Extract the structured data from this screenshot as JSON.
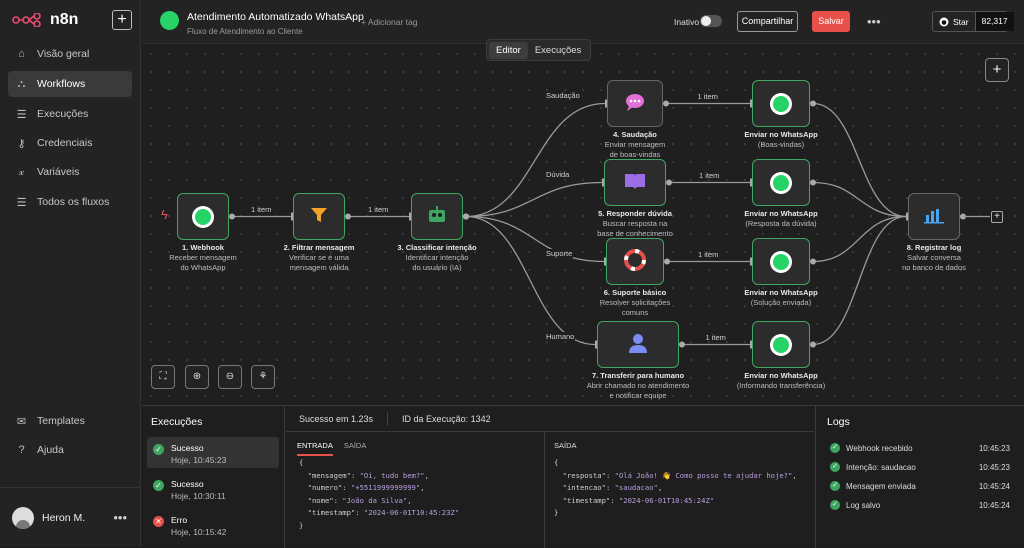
{
  "app": {
    "name": "n8n"
  },
  "sidebar": {
    "items": [
      {
        "label": "Visão geral",
        "icon": "home-icon",
        "glyph": "⌂",
        "active": false
      },
      {
        "label": "Workflows",
        "icon": "workflows-icon",
        "glyph": "⛬",
        "active": true
      },
      {
        "label": "Execuções",
        "icon": "list-icon",
        "glyph": "☰",
        "active": false
      },
      {
        "label": "Credenciais",
        "icon": "key-icon",
        "glyph": "⚷",
        "active": false
      },
      {
        "label": "Variáveis",
        "icon": "variable-icon",
        "glyph": "𝓍",
        "active": false
      },
      {
        "label": "Todos os fluxos",
        "icon": "list-icon",
        "glyph": "☰",
        "active": false
      }
    ],
    "bottom_items": [
      {
        "label": "Templates",
        "icon": "templates-icon",
        "glyph": "✉"
      },
      {
        "label": "Ajuda",
        "icon": "help-icon",
        "glyph": "?"
      }
    ],
    "user": {
      "name": "Heron M."
    }
  },
  "header": {
    "title": "Atendimento Automatizado WhatsApp",
    "subtitle": "Fluxo de Atendimento ao Cliente",
    "add_tag": "+ Adicionar tag",
    "inactive_label": "Inativo",
    "share_label": "Compartilhar",
    "save_label": "Salvar",
    "star_label": "Star",
    "star_count": "82,317",
    "tabs": [
      {
        "label": "Editor",
        "active": true
      },
      {
        "label": "Execuções",
        "active": false
      }
    ]
  },
  "canvas": {
    "nodes": [
      {
        "id": "webhook",
        "title": "1. Webhook",
        "desc": [
          "Receber mensagem",
          "do WhatsApp"
        ],
        "icon": "whatsapp-icon",
        "status": "ok"
      },
      {
        "id": "filter",
        "title": "2. Filtrar mensagem",
        "desc": [
          "Verificar se é uma",
          "mensagem válida"
        ],
        "icon": "filter-icon",
        "status": "ok"
      },
      {
        "id": "classify",
        "title": "3. Classificar intenção",
        "desc": [
          "Identificar intenção",
          "do usuário (IA)"
        ],
        "icon": "robot-icon",
        "status": "ok"
      },
      {
        "id": "greet",
        "title": "4. Saudação",
        "desc": [
          "Enviar mensagem",
          "de boas-vindas"
        ],
        "icon": "chat-bubble-icon",
        "status": "idle"
      },
      {
        "id": "answer",
        "title": "5. Responder dúvida",
        "desc": [
          "Buscar resposta na",
          "base de conhecimento"
        ],
        "icon": "book-icon",
        "status": "ok"
      },
      {
        "id": "support",
        "title": "6. Suporte básico",
        "desc": [
          "Resolver solicitações",
          "comuns"
        ],
        "icon": "lifebuoy-icon",
        "status": "ok"
      },
      {
        "id": "human",
        "title": "7. Transferir para humano",
        "desc": [
          "Abrir chamado no atendimento",
          "e notificar equipe"
        ],
        "icon": "agent-icon",
        "status": "ok"
      },
      {
        "id": "wa1",
        "title": "Enviar no WhatsApp",
        "desc": [
          "(Boas-vindas)"
        ],
        "icon": "whatsapp-icon",
        "status": "ok"
      },
      {
        "id": "wa2",
        "title": "Enviar no WhatsApp",
        "desc": [
          "(Resposta da dúvida)"
        ],
        "icon": "whatsapp-icon",
        "status": "ok"
      },
      {
        "id": "wa3",
        "title": "Enviar no WhatsApp",
        "desc": [
          "(Solução enviada)"
        ],
        "icon": "whatsapp-icon",
        "status": "ok"
      },
      {
        "id": "wa4",
        "title": "Enviar no WhatsApp",
        "desc": [
          "(Informando transferência)"
        ],
        "icon": "whatsapp-icon",
        "status": "ok"
      },
      {
        "id": "log",
        "title": "8. Registrar log",
        "desc": [
          "Salvar conversa",
          "no banco de dados"
        ],
        "icon": "chart-icon",
        "status": "idle"
      }
    ],
    "edge_items_label": "1 item",
    "branches": [
      "Saudação",
      "Dúvida",
      "Suporte",
      "Humano"
    ]
  },
  "executions": {
    "title": "Execuções",
    "items": [
      {
        "status": "Sucesso",
        "time": "Hoje, 10:45:23",
        "ok": true
      },
      {
        "status": "Sucesso",
        "time": "Hoje, 10:30:11",
        "ok": true
      },
      {
        "status": "Erro",
        "time": "Hoje, 10:15:42",
        "ok": false
      }
    ]
  },
  "detail": {
    "status": "Sucesso em 1.23s",
    "exec_id": "ID da Execução: 1342",
    "input_tab": "ENTRADA",
    "output_tab": "SAÍDA",
    "output_title": "SAÍDA",
    "input_json": [
      {
        "k": "\"mensagem\"",
        "v": "\"Oi, tudo bem?\""
      },
      {
        "k": "\"numero\"",
        "v": "\"+5511999999999\""
      },
      {
        "k": "\"nome\"",
        "v": "\"João da Silva\""
      },
      {
        "k": "\"timestamp\"",
        "v": "\"2024-06-01T10:45:23Z\""
      }
    ],
    "output_json": [
      {
        "k": "\"resposta\"",
        "v": "\"Olá João! 👋 Como posso te ajudar hoje?\""
      },
      {
        "k": "\"intencao\"",
        "v": "\"saudacao\""
      },
      {
        "k": "\"timestamp\"",
        "v": "\"2024-06-01T10:45:24Z\""
      }
    ]
  },
  "logs": {
    "title": "Logs",
    "items": [
      {
        "text": "Webhook recebido",
        "time": "10:45:23"
      },
      {
        "text": "Intenção: saudacao",
        "time": "10:45:23"
      },
      {
        "text": "Mensagem enviada",
        "time": "10:45:24"
      },
      {
        "text": "Log salvo",
        "time": "10:45:24"
      }
    ]
  },
  "colors": {
    "accent": "#e8514b",
    "success": "#3ea660",
    "whatsapp": "#25d366"
  }
}
